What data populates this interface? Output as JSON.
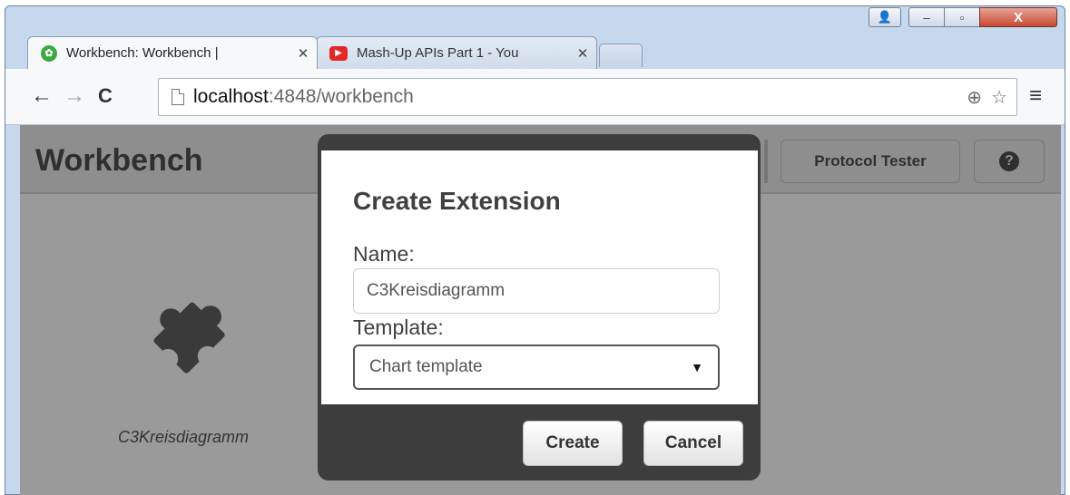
{
  "browser": {
    "tabs": [
      {
        "label": "Workbench: Workbench |",
        "favicon": "qlik-icon",
        "active": true
      },
      {
        "label": "Mash-Up APIs Part 1 - You",
        "favicon": "youtube-icon",
        "active": false
      }
    ],
    "tab_close_glyph": "✕",
    "caption": {
      "user": "👤",
      "minimize": "–",
      "maximize": "▫",
      "close": "X"
    },
    "nav": {
      "back": "←",
      "forward": "→",
      "reload": "C"
    },
    "address": {
      "host": "localhost",
      "path": ":4848/workbench"
    },
    "omni_icons": {
      "zoom": "⊕",
      "star": "☆"
    },
    "menu": "≡"
  },
  "app": {
    "title": "Workbench",
    "protocol_tester_label": "Protocol Tester",
    "help_glyph": "?",
    "extension": {
      "name": "C3Kreisdiagramm",
      "icon": "puzzle-piece-icon"
    }
  },
  "dialog": {
    "title": "Create Extension",
    "name_label": "Name:",
    "name_value": "C3Kreisdiagramm",
    "template_label": "Template:",
    "template_value": "Chart template",
    "create_label": "Create",
    "cancel_label": "Cancel"
  },
  "colors": {
    "app_background": "#9a9a9a",
    "dialog_frame": "#3d3d3d",
    "chrome_frame": "#c5d8ee"
  }
}
